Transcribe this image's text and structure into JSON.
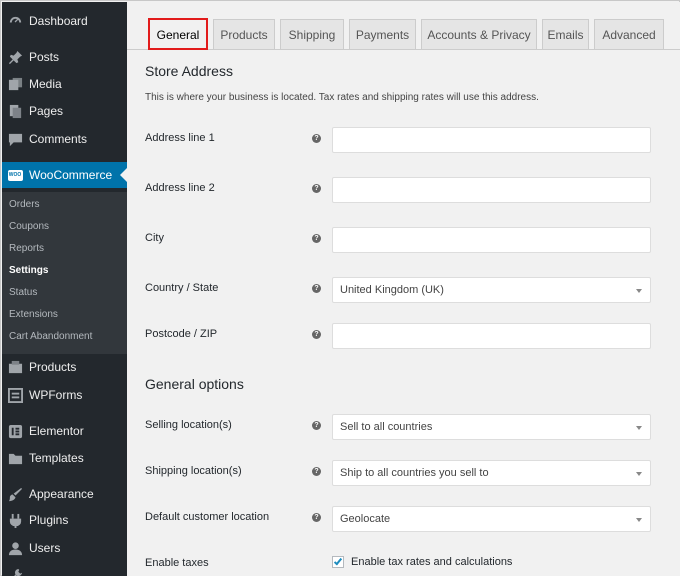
{
  "sidebar": {
    "items": [
      {
        "label": "Dashboard",
        "icon": "dashboard-icon"
      },
      {
        "label": "Posts",
        "icon": "pin-icon"
      },
      {
        "label": "Media",
        "icon": "media-icon"
      },
      {
        "label": "Pages",
        "icon": "pages-icon"
      },
      {
        "label": "Comments",
        "icon": "comment-icon"
      },
      {
        "label": "WooCommerce",
        "icon": "woo-icon",
        "icon_text": "WOO"
      },
      {
        "label": "Products",
        "icon": "products-icon"
      },
      {
        "label": "WPForms",
        "icon": "forms-icon"
      },
      {
        "label": "Elementor",
        "icon": "elementor-icon"
      },
      {
        "label": "Templates",
        "icon": "folder-icon"
      },
      {
        "label": "Appearance",
        "icon": "brush-icon"
      },
      {
        "label": "Plugins",
        "icon": "plug-icon"
      },
      {
        "label": "Users",
        "icon": "user-icon"
      }
    ],
    "submenu": [
      "Orders",
      "Coupons",
      "Reports",
      "Settings",
      "Status",
      "Extensions",
      "Cart Abandonment"
    ],
    "active_color": "#0073aa"
  },
  "tabs": [
    "General",
    "Products",
    "Shipping",
    "Payments",
    "Accounts & Privacy",
    "Emails",
    "Advanced"
  ],
  "store_address": {
    "title": "Store Address",
    "description": "This is where your business is located. Tax rates and shipping rates will use this address.",
    "fields": {
      "address1": {
        "label": "Address line 1",
        "value": ""
      },
      "address2": {
        "label": "Address line 2",
        "value": ""
      },
      "city": {
        "label": "City",
        "value": ""
      },
      "country": {
        "label": "Country / State",
        "value": "United Kingdom (UK)"
      },
      "postcode": {
        "label": "Postcode / ZIP",
        "value": ""
      }
    }
  },
  "general_options": {
    "title": "General options",
    "selling": {
      "label": "Selling location(s)",
      "value": "Sell to all countries"
    },
    "shipping": {
      "label": "Shipping location(s)",
      "value": "Ship to all countries you sell to"
    },
    "default_location": {
      "label": "Default customer location",
      "value": "Geolocate"
    },
    "taxes": {
      "label": "Enable taxes",
      "checkbox_label": "Enable tax rates and calculations",
      "checked": true
    }
  },
  "help_glyph": "?",
  "highlight_color": "#e21b1b"
}
